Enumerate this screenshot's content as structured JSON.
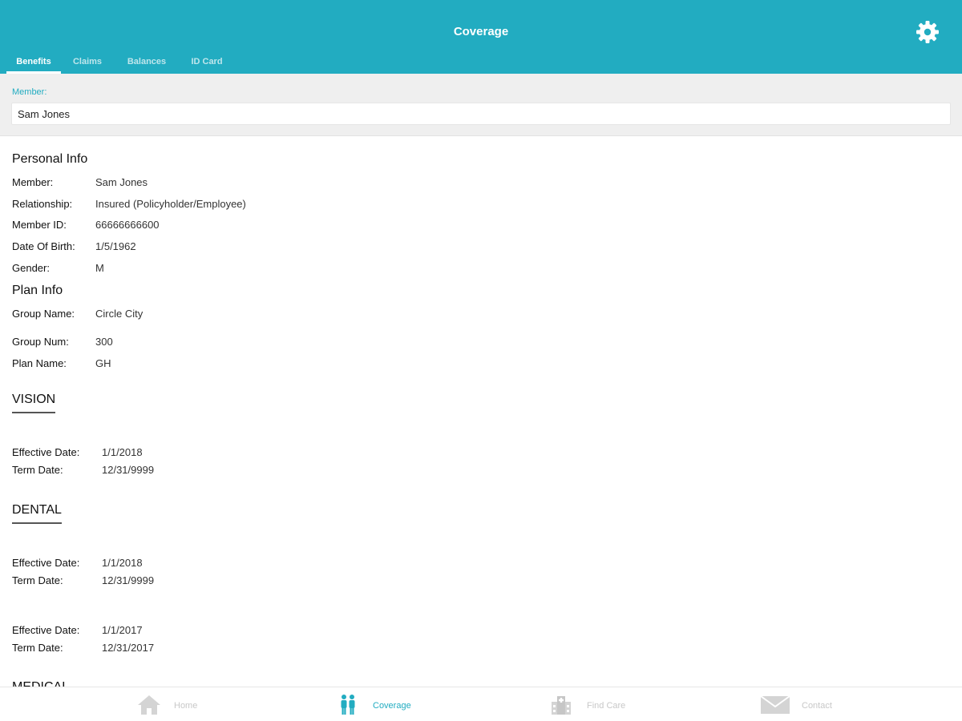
{
  "header": {
    "title": "Coverage",
    "settings_icon": "gear-icon"
  },
  "tabs": [
    {
      "label": "Benefits",
      "active": true
    },
    {
      "label": "Claims",
      "active": false
    },
    {
      "label": "Balances",
      "active": false
    },
    {
      "label": "ID Card",
      "active": false
    }
  ],
  "member_selector": {
    "label": "Member:",
    "value": "Sam Jones"
  },
  "personal_info": {
    "title": "Personal Info",
    "rows": [
      {
        "label": "Member:",
        "value": "Sam Jones"
      },
      {
        "label": "Relationship:",
        "value": "Insured (Policyholder/Employee)"
      },
      {
        "label": "Member ID:",
        "value": "66666666600"
      },
      {
        "label": "Date Of Birth:",
        "value": "1/5/1962"
      },
      {
        "label": "Gender:",
        "value": "M"
      }
    ]
  },
  "plan_info": {
    "title": "Plan Info",
    "rows": [
      {
        "label": "Group Name:",
        "value": "Circle City"
      },
      {
        "label": "Group Num:",
        "value": "300"
      },
      {
        "label": "Plan Name:",
        "value": "GH"
      }
    ]
  },
  "vision": {
    "title": "VISION",
    "periods": [
      {
        "effective_label": "Effective Date:",
        "effective": "1/1/2018",
        "term_label": "Term Date:",
        "term": "12/31/9999"
      }
    ]
  },
  "dental": {
    "title": "DENTAL",
    "periods": [
      {
        "effective_label": "Effective Date:",
        "effective": "1/1/2018",
        "term_label": "Term Date:",
        "term": "12/31/9999"
      },
      {
        "effective_label": "Effective Date:",
        "effective": "1/1/2017",
        "term_label": "Term Date:",
        "term": "12/31/2017"
      }
    ]
  },
  "medical": {
    "title": "MEDICAL"
  },
  "bottom_nav": [
    {
      "label": "Home",
      "icon": "home-icon",
      "active": false
    },
    {
      "label": "Coverage",
      "icon": "people-icon",
      "active": true
    },
    {
      "label": "Find Care",
      "icon": "building-icon",
      "active": false
    },
    {
      "label": "Contact",
      "icon": "envelope-icon",
      "active": false
    }
  ],
  "colors": {
    "accent": "#22acc1",
    "inactive_nav": "#c8c8c8",
    "member_bar": "#efefef"
  }
}
